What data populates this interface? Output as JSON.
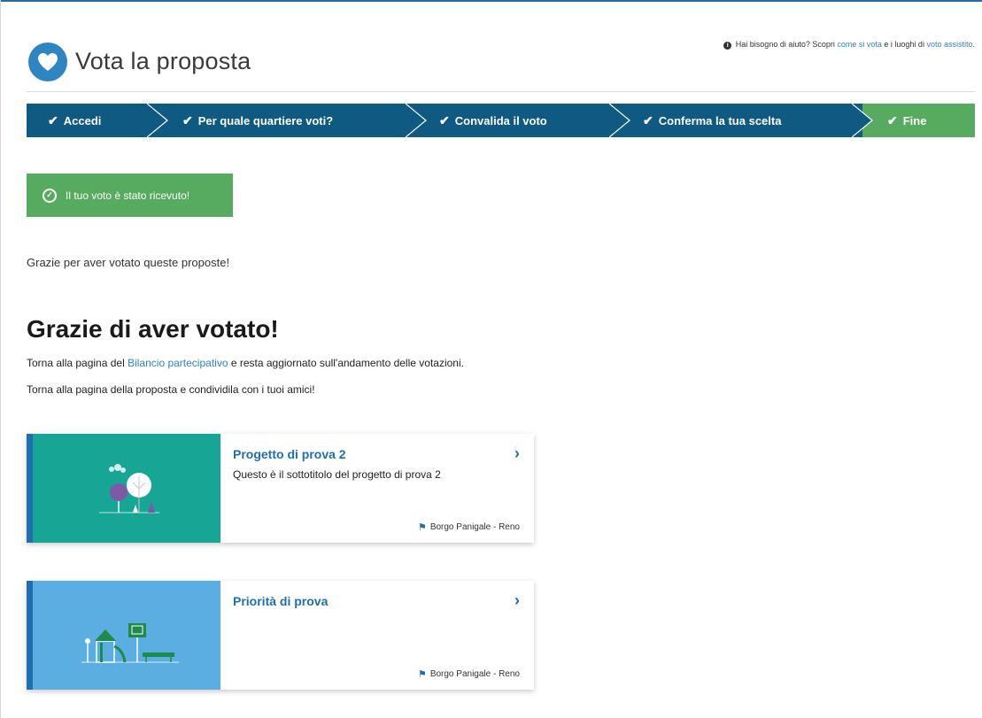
{
  "header": {
    "title": "Vota la proposta",
    "help": {
      "prefix": "Hai bisogno di aiuto? Scopri ",
      "link1": "come si vota",
      "middle": " e i luoghi di ",
      "link2": "voto assistito",
      "suffix": "."
    }
  },
  "steps": [
    {
      "label": "Accedi"
    },
    {
      "label": "Per quale quartiere voti?"
    },
    {
      "label": "Convalida il voto"
    },
    {
      "label": "Conferma la tua scelta"
    },
    {
      "label": "Fine"
    }
  ],
  "alert": {
    "text": "Il tuo voto è stato ricevuto!"
  },
  "thanks_text": "Grazie per aver votato queste proposte!",
  "heading": "Grazie di aver votato!",
  "line1": {
    "before": "Torna alla pagina del ",
    "link": "Bilancio partecipativo",
    "after": " e resta aggiornato sull'andamento delle votazioni."
  },
  "line2": "Torna alla pagina della proposta e condividila con i tuoi amici!",
  "cards": [
    {
      "title": "Progetto di prova 2",
      "subtitle": "Questo è il sottotitolo del progetto di prova 2",
      "location": "Borgo Panigale - Reno"
    },
    {
      "title": "Priorità di prova",
      "subtitle": "",
      "location": "Borgo Panigale - Reno"
    }
  ],
  "colors": {
    "brand_blue": "#2e86c1",
    "stepper_dark": "#0e5a83",
    "success_green": "#57ab60",
    "card1_bg": "#17a696",
    "card2_bg": "#5aaee1"
  },
  "icons": {
    "logo": "heart-icon",
    "help": "info-circle-icon",
    "step_done": "check-icon",
    "alert": "check-circle-icon",
    "card_arrow": "chevron-right-icon",
    "location": "flag-icon"
  }
}
